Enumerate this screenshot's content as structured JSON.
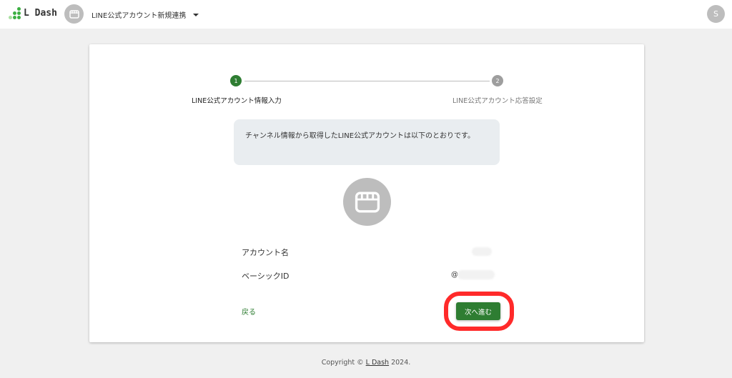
{
  "header": {
    "logo_text": "L Dash",
    "account_name": "LINE公式アカウント新規連携",
    "user_initial": "S"
  },
  "stepper": {
    "steps": [
      {
        "number": "1",
        "label": "LINE公式アカウント情報入力",
        "active": true
      },
      {
        "number": "2",
        "label": "LINE公式アカウント応答設定",
        "active": false
      }
    ]
  },
  "info_message": "チャンネル情報から取得したLINE公式アカウントは以下のとおりです。",
  "fields": {
    "account_name_label": "アカウント名",
    "basic_id_label": "ベーシックID",
    "basic_id_prefix": "@"
  },
  "actions": {
    "back": "戻る",
    "next": "次へ進む"
  },
  "footer": {
    "prefix": "Copyright © ",
    "link": "L Dash",
    "suffix": " 2024."
  },
  "colors": {
    "primary": "#2e7d32",
    "highlight": "#ff2a2a",
    "step_inactive": "#9e9e9e"
  }
}
